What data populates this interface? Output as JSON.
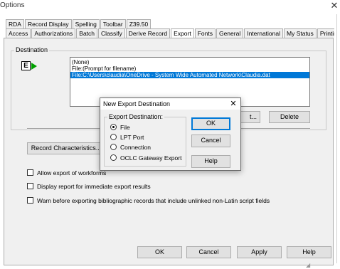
{
  "window": {
    "title": "Options",
    "close_glyph": "✕"
  },
  "tabs_row1": [
    "RDA",
    "Record Display",
    "Spelling",
    "Toolbar",
    "Z39.50"
  ],
  "tabs_row2": [
    "Access",
    "Authorizations",
    "Batch",
    "Classify",
    "Derive Record",
    "Export",
    "Fonts",
    "General",
    "International",
    "My Status",
    "Printing"
  ],
  "active_tab": "Export",
  "destination": {
    "label": "Destination",
    "icon": "export-icon",
    "list": [
      "(None)",
      "File:(Prompt for filename)",
      "File:C:\\Users\\claudia\\OneDrive - System Wide Automated Network\\Claudia.dat"
    ],
    "selected_index": 2,
    "edit_button_partial": "t...",
    "delete_button": "Delete"
  },
  "record_characteristics_button": "Record Characteristics...",
  "checkboxes": [
    {
      "label": "Allow export of workforms",
      "checked": false
    },
    {
      "label": "Display report for immediate export results",
      "checked": false
    },
    {
      "label": "Warn before exporting bibliographic records that include unlinked non-Latin script fields",
      "checked": false
    }
  ],
  "footer_buttons": {
    "ok": "OK",
    "cancel": "Cancel",
    "apply": "Apply",
    "help": "Help"
  },
  "dialog": {
    "title": "New Export Destination",
    "close_glyph": "✕",
    "group_label": "Export Destination:",
    "options": [
      "File",
      "LPT Port",
      "Connection",
      "OCLC Gateway Export"
    ],
    "selected_option": "File",
    "buttons": {
      "ok": "OK",
      "cancel": "Cancel",
      "help": "Help"
    }
  },
  "colors": {
    "selection": "#0078d7",
    "dialog_bg": "#f0f0f0",
    "accent_arrow": "#00a000"
  }
}
